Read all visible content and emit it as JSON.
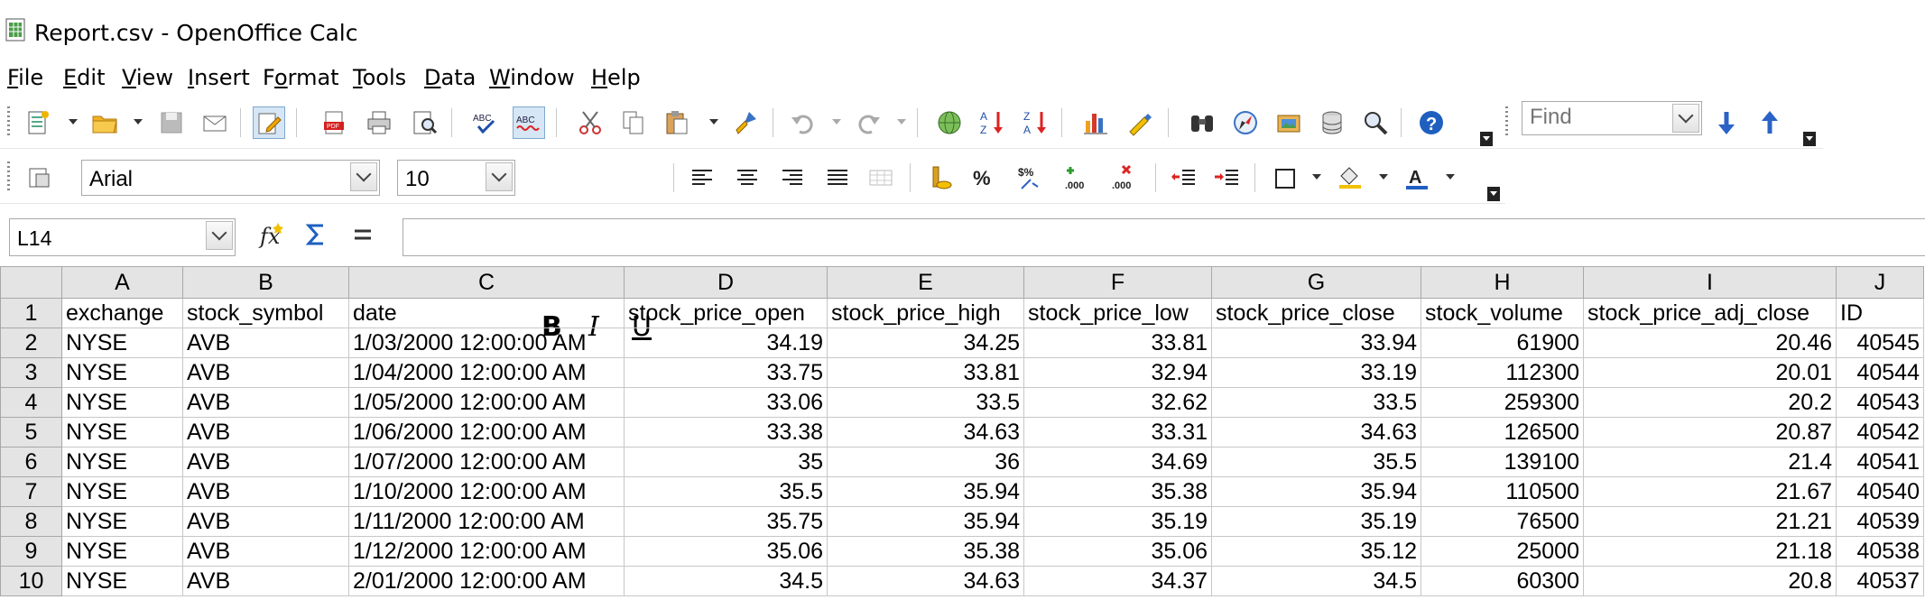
{
  "window": {
    "title": "Report.csv - OpenOffice Calc"
  },
  "menu": [
    {
      "pre": "",
      "ul": "F",
      "post": "ile"
    },
    {
      "pre": "",
      "ul": "E",
      "post": "dit"
    },
    {
      "pre": "",
      "ul": "V",
      "post": "iew"
    },
    {
      "pre": "",
      "ul": "I",
      "post": "nsert"
    },
    {
      "pre": "F",
      "ul": "o",
      "post": "rmat"
    },
    {
      "pre": "",
      "ul": "T",
      "post": "ools"
    },
    {
      "pre": "",
      "ul": "D",
      "post": "ata"
    },
    {
      "pre": "",
      "ul": "W",
      "post": "indow"
    },
    {
      "pre": "",
      "ul": "H",
      "post": "elp"
    }
  ],
  "find": {
    "placeholder": "Find"
  },
  "formatting": {
    "font_name": "Arial",
    "font_size": "10",
    "bold": "B",
    "italic": "I",
    "underline": "U"
  },
  "formula_bar": {
    "name_box": "L14",
    "formula": ""
  },
  "sheet": {
    "columns": [
      "A",
      "B",
      "C",
      "D",
      "E",
      "F",
      "G",
      "H",
      "I",
      "J"
    ],
    "rows": [
      {
        "n": "1",
        "cells": [
          "exchange",
          "stock_symbol",
          "date",
          "stock_price_open",
          "stock_price_high",
          "stock_price_low",
          "stock_price_close",
          "stock_volume",
          "stock_price_adj_close",
          "ID"
        ]
      },
      {
        "n": "2",
        "cells": [
          "NYSE",
          "AVB",
          "1/03/2000 12:00:00 AM",
          "34.19",
          "34.25",
          "33.81",
          "33.94",
          "61900",
          "20.46",
          "40545"
        ]
      },
      {
        "n": "3",
        "cells": [
          "NYSE",
          "AVB",
          "1/04/2000 12:00:00 AM",
          "33.75",
          "33.81",
          "32.94",
          "33.19",
          "112300",
          "20.01",
          "40544"
        ]
      },
      {
        "n": "4",
        "cells": [
          "NYSE",
          "AVB",
          "1/05/2000 12:00:00 AM",
          "33.06",
          "33.5",
          "32.62",
          "33.5",
          "259300",
          "20.2",
          "40543"
        ]
      },
      {
        "n": "5",
        "cells": [
          "NYSE",
          "AVB",
          "1/06/2000 12:00:00 AM",
          "33.38",
          "34.63",
          "33.31",
          "34.63",
          "126500",
          "20.87",
          "40542"
        ]
      },
      {
        "n": "6",
        "cells": [
          "NYSE",
          "AVB",
          "1/07/2000 12:00:00 AM",
          "35",
          "36",
          "34.69",
          "35.5",
          "139100",
          "21.4",
          "40541"
        ]
      },
      {
        "n": "7",
        "cells": [
          "NYSE",
          "AVB",
          "1/10/2000 12:00:00 AM",
          "35.5",
          "35.94",
          "35.38",
          "35.94",
          "110500",
          "21.67",
          "40540"
        ]
      },
      {
        "n": "8",
        "cells": [
          "NYSE",
          "AVB",
          "1/11/2000 12:00:00 AM",
          "35.75",
          "35.94",
          "35.19",
          "35.19",
          "76500",
          "21.21",
          "40539"
        ]
      },
      {
        "n": "9",
        "cells": [
          "NYSE",
          "AVB",
          "1/12/2000 12:00:00 AM",
          "35.06",
          "35.38",
          "35.06",
          "35.12",
          "25000",
          "21.18",
          "40538"
        ]
      },
      {
        "n": "10",
        "cells": [
          "NYSE",
          "AVB",
          "2/01/2000 12:00:00 AM",
          "34.5",
          "34.63",
          "34.37",
          "34.5",
          "60300",
          "20.8",
          "40537"
        ]
      }
    ]
  }
}
